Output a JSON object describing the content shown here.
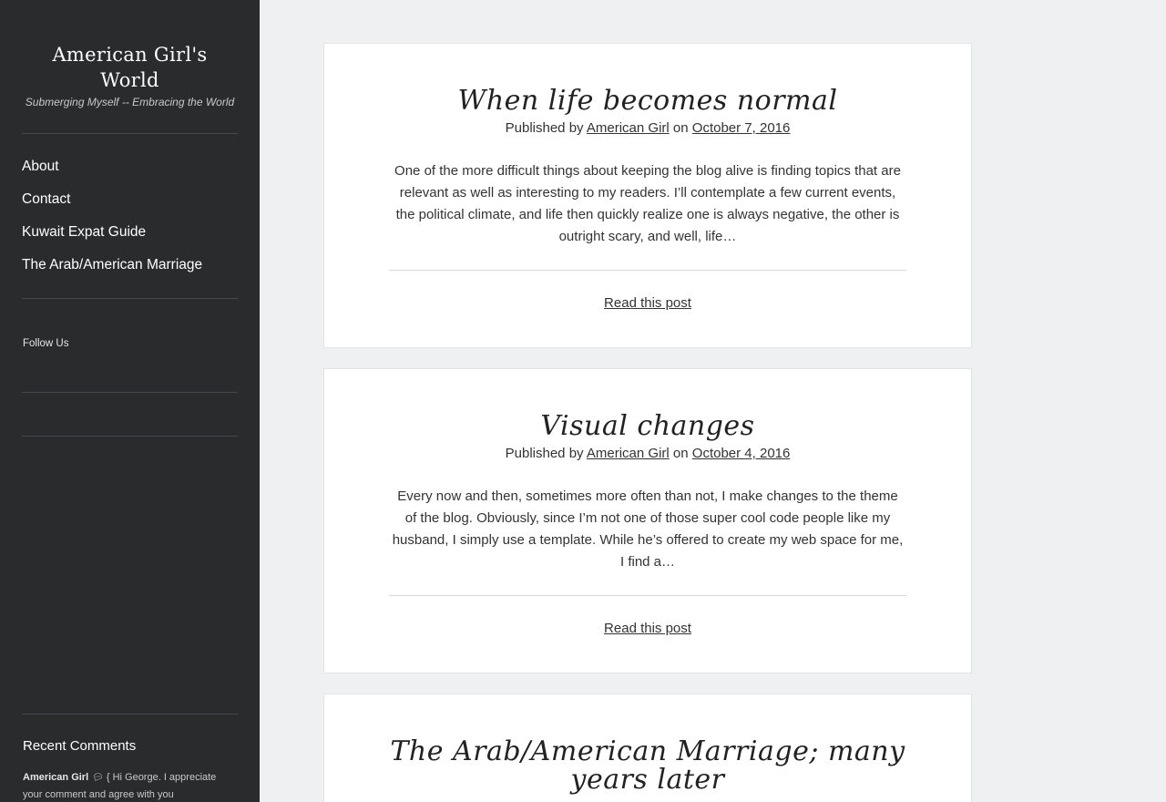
{
  "sidebar": {
    "site_title": "American Girl's World",
    "tagline": "Submerging Myself -- Embracing the World",
    "nav": [
      {
        "label": "About"
      },
      {
        "label": "Contact"
      },
      {
        "label": "Kuwait Expat Guide"
      },
      {
        "label": "The Arab/American Marriage"
      }
    ],
    "follow_label": "Follow Us",
    "recent_comments": {
      "heading": "Recent Comments",
      "author": "American Girl",
      "icon": "comment-bubble-icon",
      "excerpt": "{ Hi George. I appreciate your comment and agree with you"
    }
  },
  "posts": [
    {
      "title": "When life becomes normal",
      "published_by": "Published by",
      "author": "American Girl",
      "on": "on",
      "date": "October 7, 2016",
      "excerpt": "One of the more difficult things about keeping the blog alive is finding topics that are relevant as well as interesting to my readers. I’ll contemplate a few current events, the political climate, and life then quickly realize one is always negative, the other is outright scary, and well, life…",
      "read_more": "Read this post"
    },
    {
      "title": "Visual changes",
      "published_by": "Published by",
      "author": "American Girl",
      "on": "on",
      "date": "October 4, 2016",
      "excerpt": "Every now and then, sometimes more often than not, I make changes to the theme of the blog. Obviously, since I’m not one of those super cool code people like my husband, I simply use a template. While he’s offered to create my web space for me, I find a…",
      "read_more": "Read this post"
    },
    {
      "title": "The Arab/American Marriage; many years later"
    }
  ],
  "colors": {
    "sidebar_bg": "#2a2b2d",
    "page_bg": "#eff0f1",
    "card_bg": "#ffffff"
  }
}
